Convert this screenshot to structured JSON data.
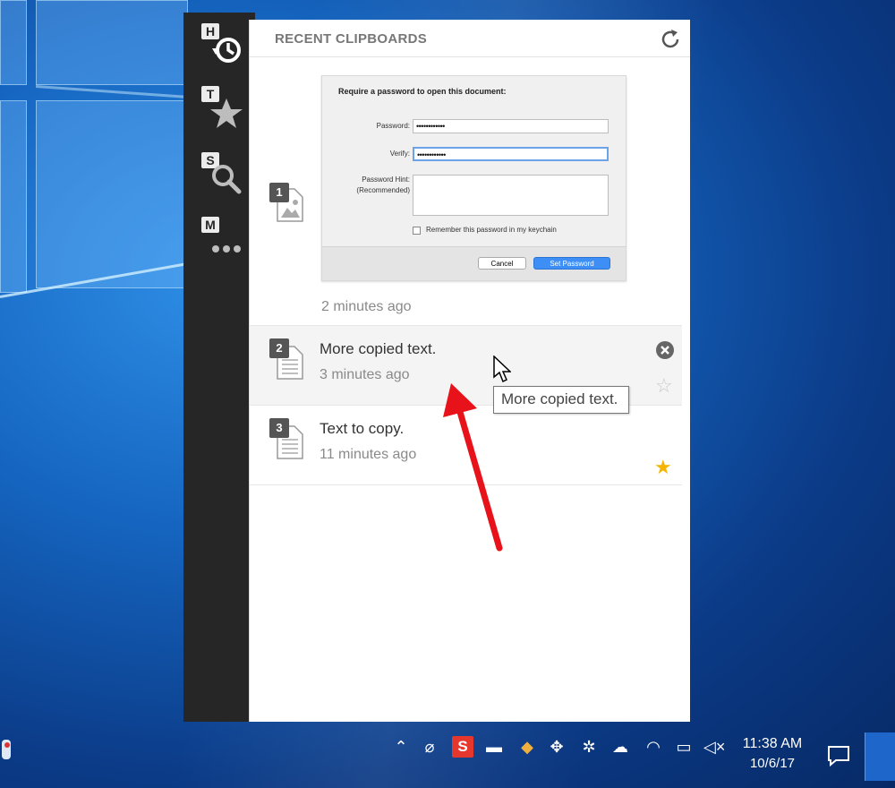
{
  "panel": {
    "title": "RECENT CLIPBOARDS"
  },
  "sidebar": {
    "items": [
      {
        "key": "H",
        "icon": "history-icon"
      },
      {
        "key": "T",
        "icon": "star-icon"
      },
      {
        "key": "S",
        "icon": "search-icon"
      },
      {
        "key": "M",
        "icon": "more-icon"
      }
    ]
  },
  "clips": [
    {
      "number": "1",
      "type": "image",
      "time": "2 minutes ago",
      "thumbnail": {
        "title": "Require a password to open this document:",
        "password_label": "Password:",
        "password_value": "••••••••••••",
        "verify_label": "Verify:",
        "verify_value": "••••••••••••",
        "hint_label": "Password Hint:\n(Recommended)",
        "remember_label": "Remember this password in my keychain",
        "cancel_label": "Cancel",
        "set_label": "Set Password"
      }
    },
    {
      "number": "2",
      "type": "text",
      "text": "More copied text.",
      "time": "3 minutes ago",
      "starred": false
    },
    {
      "number": "3",
      "type": "text",
      "text": "Text to copy.",
      "time": "11 minutes ago",
      "starred": true
    }
  ],
  "tooltip": "More copied text.",
  "taskbar": {
    "time": "11:38 AM",
    "date": "10/6/17",
    "tray_icons": [
      "chevron-up-icon",
      "paperclip-icon",
      "snagit-icon",
      "network-drive-icon",
      "color-picker-icon",
      "move-icon",
      "gear-icon",
      "onedrive-icon",
      "wifi-icon",
      "power-icon",
      "volume-muted-icon"
    ]
  },
  "colors": {
    "accent_arrow": "#e8121b",
    "star_active": "#f5b400",
    "sidebar": "#262626"
  }
}
